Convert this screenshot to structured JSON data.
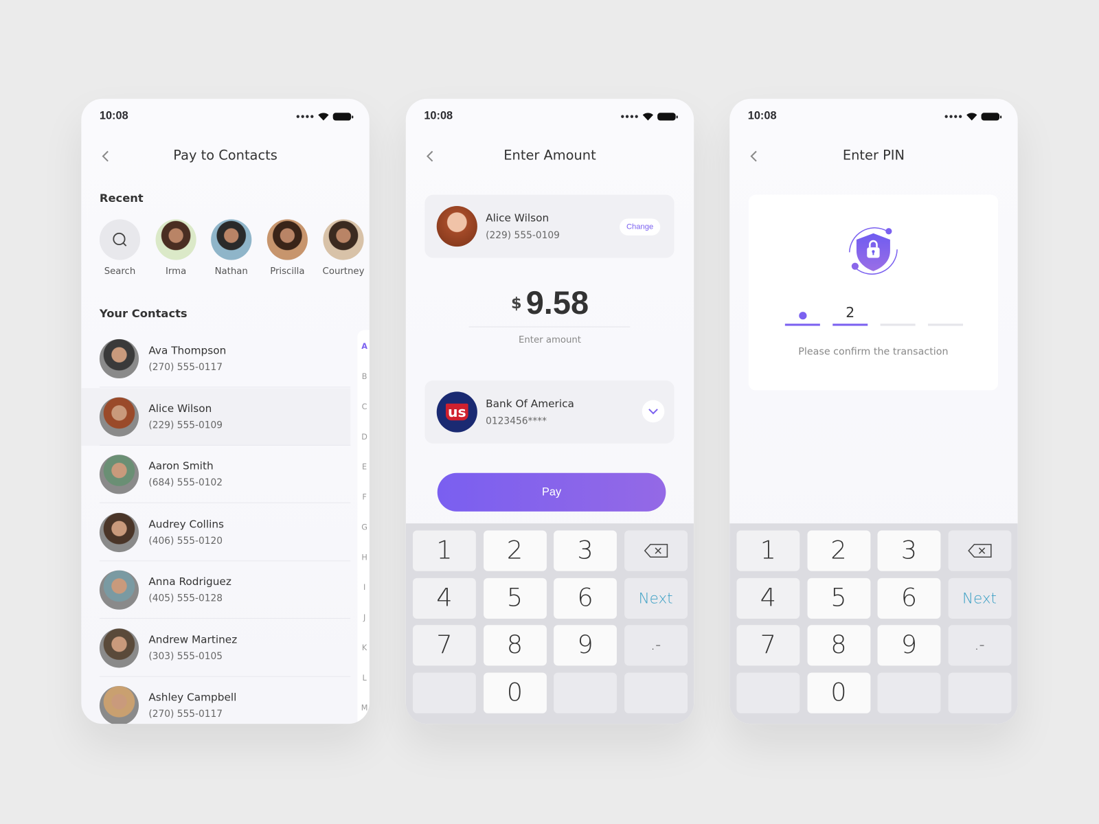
{
  "status_time": "10:08",
  "colors": {
    "accent": "#7b61f0",
    "next_key": "#3a9fc4",
    "background": "#ebebeb"
  },
  "screen1": {
    "title": "Pay to Contacts",
    "recent_heading": "Recent",
    "recent": [
      {
        "label": "Search",
        "icon": "search-icon"
      },
      {
        "label": "Irma"
      },
      {
        "label": "Nathan"
      },
      {
        "label": "Priscilla"
      },
      {
        "label": "Courtney"
      }
    ],
    "contacts_heading": "Your Contacts",
    "contacts": [
      {
        "name": "Ava Thompson",
        "phone": "(270) 555-0117"
      },
      {
        "name": "Alice Wilson",
        "phone": "(229) 555-0109",
        "selected": true
      },
      {
        "name": "Aaron Smith",
        "phone": "(684) 555-0102"
      },
      {
        "name": "Audrey Collins",
        "phone": "(406) 555-0120"
      },
      {
        "name": "Anna Rodriguez",
        "phone": "(405) 555-0128"
      },
      {
        "name": "Andrew Martinez",
        "phone": "(303) 555-0105"
      },
      {
        "name": "Ashley Campbell",
        "phone": "(270) 555-0117"
      }
    ],
    "alphabet": [
      "A",
      "B",
      "C",
      "D",
      "E",
      "F",
      "G",
      "H",
      "I",
      "J",
      "K",
      "L",
      "M"
    ],
    "alphabet_active": "A"
  },
  "screen2": {
    "title": "Enter Amount",
    "recipient": {
      "name": "Alice Wilson",
      "phone": "(229) 555-0109",
      "change_label": "Change"
    },
    "currency": "$",
    "amount": "9.58",
    "amount_hint": "Enter amount",
    "bank": {
      "name": "Bank Of America",
      "account": "0123456****",
      "logo_text": "us"
    },
    "pay_label": "Pay"
  },
  "screen3": {
    "title": "Enter PIN",
    "pin_entered": [
      "•",
      "2",
      "",
      ""
    ],
    "message": "Please confirm the transaction"
  },
  "keypad": [
    "1",
    "2",
    "3",
    "backspace",
    "4",
    "5",
    "6",
    "Next",
    "7",
    "8",
    "9",
    ".-",
    "",
    "0",
    "",
    ""
  ]
}
